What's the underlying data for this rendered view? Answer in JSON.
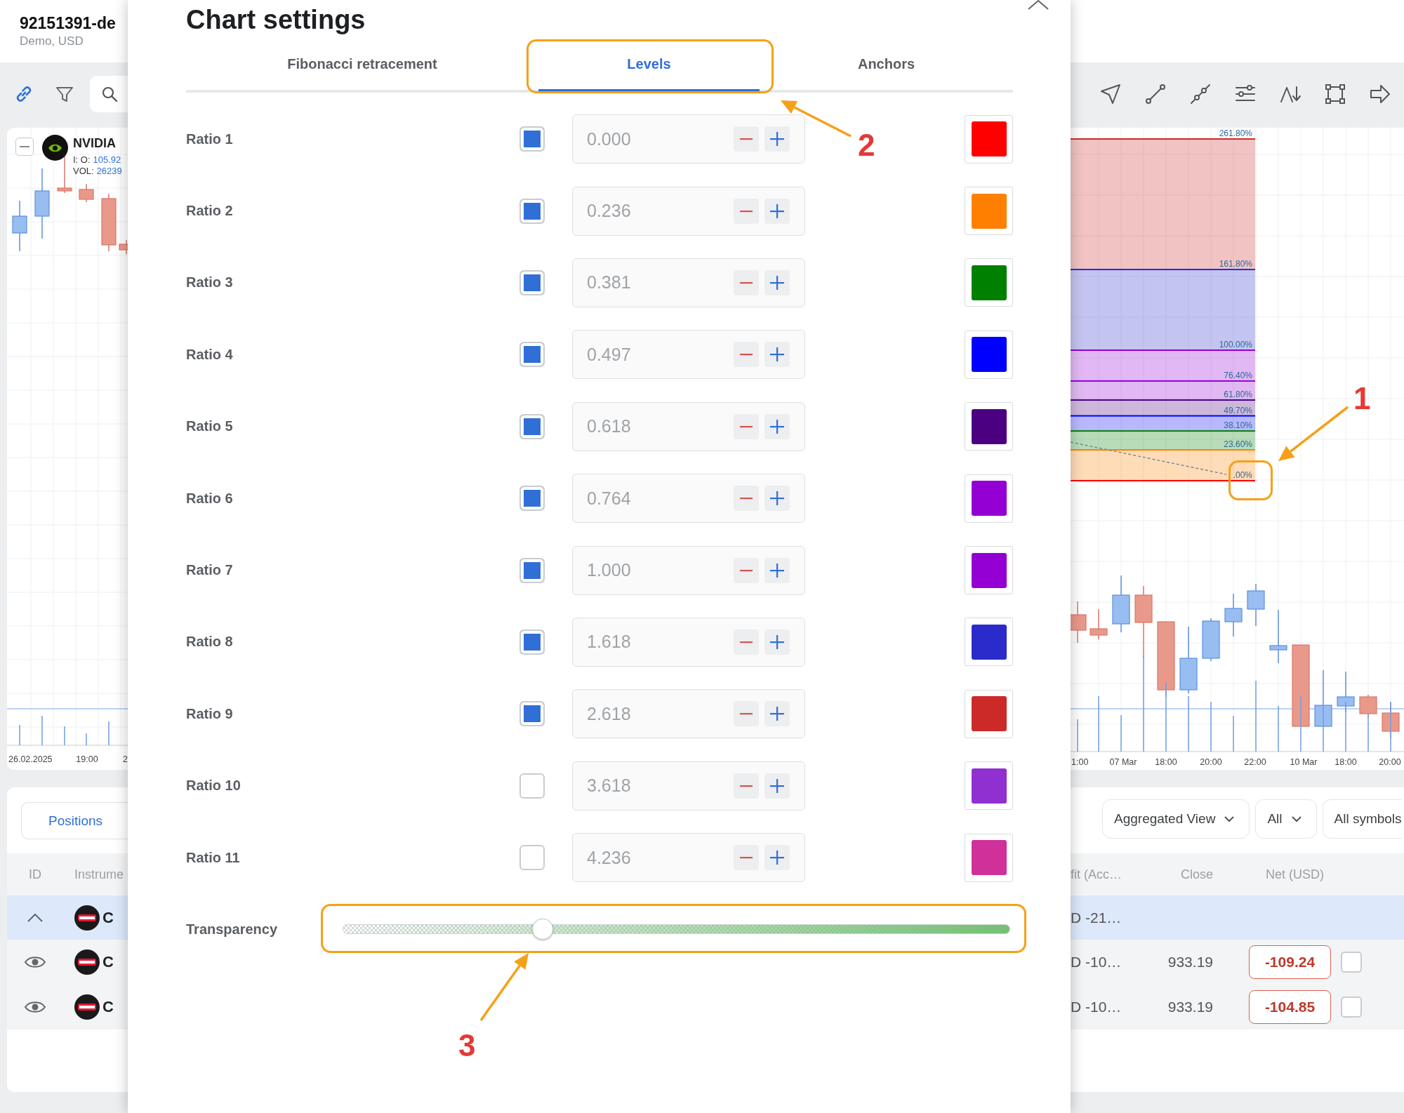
{
  "account": {
    "id": "92151391-de",
    "subtitle": "Demo, USD"
  },
  "left_chart": {
    "symbol": "NVIDIA",
    "legend": [
      {
        "label": "I: O:",
        "value": "105.92"
      },
      {
        "label": "VOL:",
        "value": "26239"
      }
    ],
    "x_labels": [
      "26.02.2025",
      "19:00",
      "2"
    ]
  },
  "dialog": {
    "title": "Chart settings",
    "tabs": [
      {
        "label": "Fibonacci retracement",
        "selected": false
      },
      {
        "label": "Levels",
        "selected": true
      },
      {
        "label": "Anchors",
        "selected": false
      }
    ],
    "levels": [
      {
        "label": "Ratio 1",
        "checked": true,
        "value": "0.000",
        "color": "#ff0000"
      },
      {
        "label": "Ratio 2",
        "checked": true,
        "value": "0.236",
        "color": "#ff8000"
      },
      {
        "label": "Ratio 3",
        "checked": true,
        "value": "0.381",
        "color": "#008000"
      },
      {
        "label": "Ratio 4",
        "checked": true,
        "value": "0.497",
        "color": "#0000ff"
      },
      {
        "label": "Ratio 5",
        "checked": true,
        "value": "0.618",
        "color": "#4b0082"
      },
      {
        "label": "Ratio 6",
        "checked": true,
        "value": "0.764",
        "color": "#9400d3"
      },
      {
        "label": "Ratio 7",
        "checked": true,
        "value": "1.000",
        "color": "#9400d3"
      },
      {
        "label": "Ratio 8",
        "checked": true,
        "value": "1.618",
        "color": "#2b2bcc"
      },
      {
        "label": "Ratio 9",
        "checked": true,
        "value": "2.618",
        "color": "#cc2929"
      },
      {
        "label": "Ratio 10",
        "checked": false,
        "value": "3.618",
        "color": "#9030d0"
      },
      {
        "label": "Ratio 11",
        "checked": false,
        "value": "4.236",
        "color": "#d0309a"
      }
    ],
    "transparency": {
      "label": "Transparency",
      "level": 0.3
    }
  },
  "right_chart": {
    "fib_levels": [
      {
        "label": "261.80%",
        "color": "#cc2929"
      },
      {
        "label": "161.80%",
        "color": "#2b2bcc"
      },
      {
        "label": "100.00%",
        "color": "#9400d3"
      },
      {
        "label": "76.40%",
        "color": "#9400d3"
      },
      {
        "label": "61.80%",
        "color": "#4b0082"
      },
      {
        "label": "49.70%",
        "color": "#0000ff"
      },
      {
        "label": "38.10%",
        "color": "#008000"
      },
      {
        "label": "23.60%",
        "color": "#ff8000"
      },
      {
        "label": ".00%",
        "color": "#ff0000"
      }
    ],
    "x_labels": [
      "1:00",
      "07 Mar",
      "18:00",
      "20:00",
      "22:00",
      "10 Mar",
      "18:00",
      "20:00"
    ]
  },
  "positions": {
    "tab": "Positions",
    "filters": [
      {
        "label": "Aggregated View",
        "caret": true
      },
      {
        "label": "All",
        "caret": true
      },
      {
        "label": "All symbols",
        "caret": false
      }
    ],
    "columns": [
      "ID",
      "Instrume",
      "fit (Acc…",
      "Close",
      "Net (USD)"
    ],
    "rows": [
      {
        "kind": "group",
        "selected": true,
        "expanded": true,
        "instrument": "C",
        "profit": "D -21…"
      },
      {
        "kind": "position",
        "selected": false,
        "checked": false,
        "instrument": "C",
        "profit": "D -10…",
        "close": "933.19",
        "net": "-109.24"
      },
      {
        "kind": "position",
        "selected": false,
        "checked": false,
        "instrument": "C",
        "profit": "D -10…",
        "close": "933.19",
        "net": "-104.85"
      }
    ]
  },
  "annotations": [
    {
      "number": "1"
    },
    {
      "number": "2"
    },
    {
      "number": "3"
    }
  ]
}
